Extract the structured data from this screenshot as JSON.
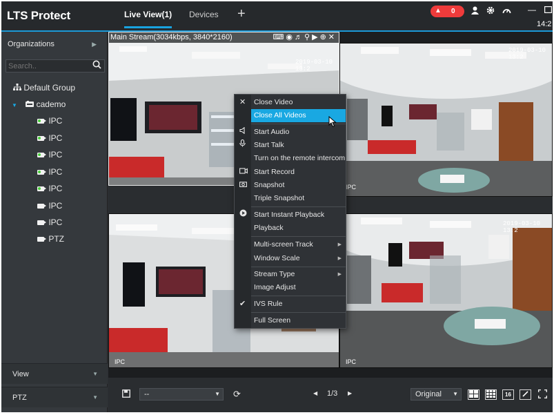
{
  "app": {
    "logo": "LTS Protect",
    "tabs": [
      {
        "label": "Live View(1)",
        "active": true
      },
      {
        "label": "Devices",
        "active": false
      }
    ],
    "add_tab_icon": "plus-icon",
    "alarm_count": "0",
    "clock": "14:2",
    "accent_color": "#1b9ad8",
    "alarm_color": "#ef3b3b"
  },
  "sidebar": {
    "organizations_label": "Organizations",
    "search_placeholder": "Search..",
    "tree": {
      "group": "Default Group",
      "device": "cademo",
      "channels": [
        "IPC",
        "IPC",
        "IPC",
        "IPC",
        "IPC",
        "IPC",
        "IPC",
        "PTZ"
      ]
    },
    "view_label": "View",
    "ptz_label": "PTZ"
  },
  "video": {
    "panes": [
      {
        "stream_info": "Main Stream(3034kbps, 3840*2160)",
        "timestamp": "2019-03-10 13:2",
        "label": ""
      },
      {
        "stream_info": "",
        "timestamp": "2019-03-10 13:2",
        "label": "IPC"
      },
      {
        "stream_info": "",
        "timestamp": "",
        "label": "IPC"
      },
      {
        "stream_info": "",
        "timestamp": "2019-03-10 13:2",
        "label": "IPC"
      }
    ]
  },
  "context_menu": {
    "items": [
      {
        "label": "Close Video",
        "icon": "close-icon"
      },
      {
        "label": "Close All Videos",
        "highlighted": true
      },
      {
        "label": "Start Audio",
        "icon": "speaker-icon"
      },
      {
        "label": "Start Talk",
        "icon": "microphone-icon"
      },
      {
        "label": "Turn on the remote intercom"
      },
      {
        "label": "Start Record",
        "icon": "record-icon"
      },
      {
        "label": "Snapshot",
        "icon": "camera-icon"
      },
      {
        "label": "Triple Snapshot"
      },
      {
        "label": "Start Instant Playback",
        "icon": "play-icon"
      },
      {
        "label": "Playback"
      },
      {
        "label": "Multi-screen Track",
        "submenu": true
      },
      {
        "label": "Window Scale",
        "submenu": true
      },
      {
        "label": "Stream Type",
        "submenu": true
      },
      {
        "label": "Image Adjust"
      },
      {
        "label": "IVS Rule",
        "checked": true
      },
      {
        "label": "Full Screen"
      }
    ]
  },
  "toolbar": {
    "view_select_value": "--",
    "page": "1/3",
    "scale_select_value": "Original",
    "layout_16_label": "16"
  }
}
